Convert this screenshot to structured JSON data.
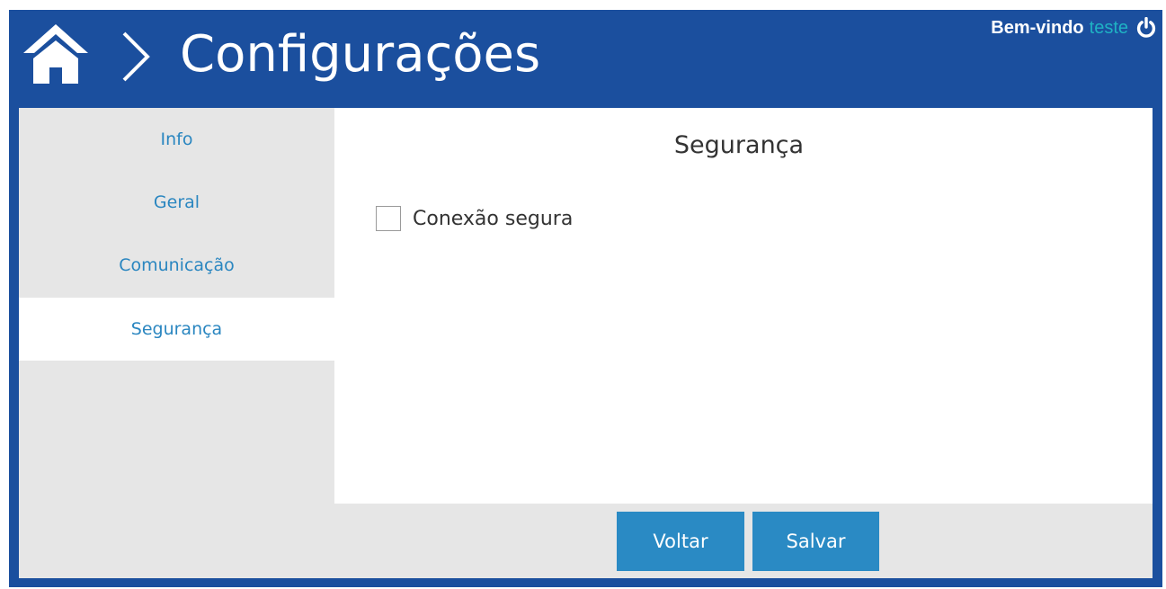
{
  "header": {
    "title": "Configurações",
    "welcome_label": "Bem-vindo",
    "username": "teste",
    "home_icon": "home-icon",
    "chevron_icon": "chevron-right-icon",
    "power_icon": "power-icon"
  },
  "sidebar": {
    "items": [
      {
        "label": "Info",
        "active": false
      },
      {
        "label": "Geral",
        "active": false
      },
      {
        "label": "Comunicação",
        "active": false
      },
      {
        "label": "Segurança",
        "active": true
      }
    ]
  },
  "main": {
    "section_title": "Segurança",
    "secure_connection": {
      "label": "Conexão segura",
      "checked": false
    }
  },
  "footer": {
    "back_label": "Voltar",
    "save_label": "Salvar"
  },
  "colors": {
    "header_bg": "#1b4f9e",
    "accent": "#2a8ac4",
    "username": "#1fb3c4",
    "panel_bg": "#e6e6e6"
  }
}
